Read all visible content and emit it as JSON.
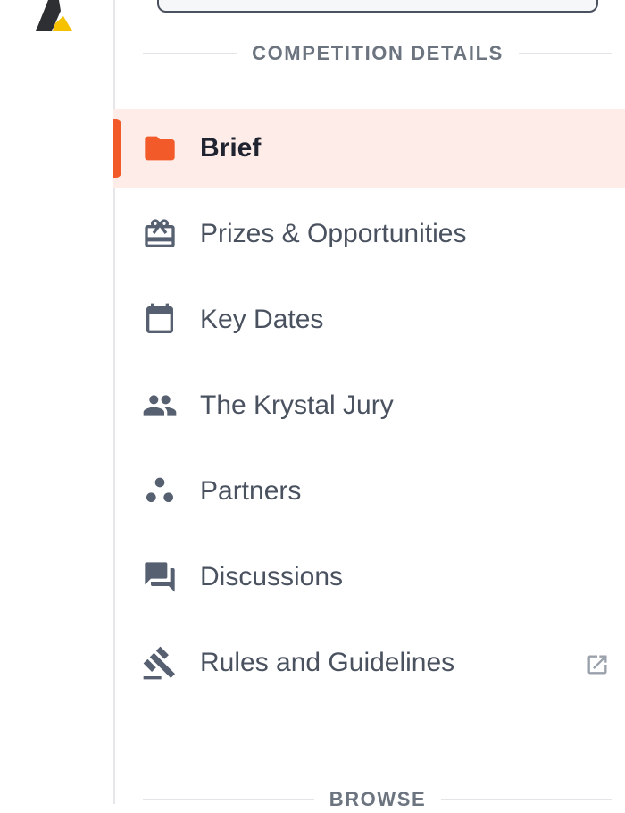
{
  "colors": {
    "accent": "#f25a29",
    "active_bg": "#fdece7",
    "icon": "#566070",
    "text": "#4a5260",
    "active_text": "#1f2430",
    "heading": "#6c7480",
    "logo_dark": "#2e2f33",
    "logo_yellow": "#f6c200"
  },
  "sidebar": {
    "sections": [
      {
        "heading": "COMPETITION DETAILS",
        "items": [
          {
            "label": "Brief",
            "icon": "folder-icon",
            "active": true
          },
          {
            "label": "Prizes & Opportunities",
            "icon": "gift-card-icon"
          },
          {
            "label": "Key Dates",
            "icon": "calendar-icon"
          },
          {
            "label": "The Krystal Jury",
            "icon": "people-icon"
          },
          {
            "label": "Partners",
            "icon": "bubble-chart-icon"
          },
          {
            "label": "Discussions",
            "icon": "forum-icon"
          },
          {
            "label": "Rules and Guidelines",
            "icon": "gavel-icon",
            "trailing_icon": "open-in-new-icon"
          }
        ]
      },
      {
        "heading": "BROWSE"
      }
    ]
  }
}
